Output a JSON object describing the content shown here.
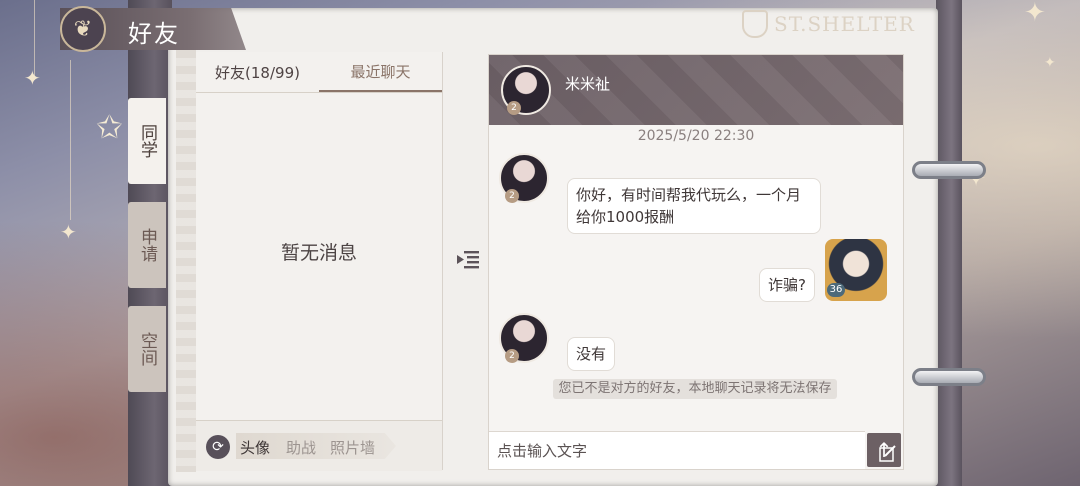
{
  "header": {
    "title": "好友",
    "brand": "ST.SHELTER"
  },
  "side_tabs": [
    {
      "label": "同学",
      "active": true
    },
    {
      "label": "申请",
      "active": false
    },
    {
      "label": "空间",
      "active": false
    }
  ],
  "friends_panel": {
    "tabs": [
      {
        "label": "好友(18/99)",
        "active": false
      },
      {
        "label": "最近聊天",
        "active": true
      }
    ],
    "empty_text": "暂无消息",
    "footer": {
      "options": [
        "头像",
        "助战",
        "照片墙"
      ],
      "active_index": 0
    }
  },
  "chat": {
    "contact_name": "米米祉",
    "contact_level": "2",
    "timestamp": "2025/5/20  22:30",
    "messages": [
      {
        "from": "other",
        "text": "你好，有时间帮我代玩么，一个月给你1000报酬",
        "level": "2"
      },
      {
        "from": "self",
        "text": "诈骗?",
        "level": "36"
      },
      {
        "from": "other",
        "text": "没有",
        "level": "2"
      }
    ],
    "notice": "您已不是对方的好友，本地聊天记录将无法保存",
    "input_placeholder": "点击输入文字"
  },
  "colors": {
    "accent": "#6c6064",
    "page": "#f1efec",
    "text": "#3f3737"
  },
  "icons": [
    "butterfly-emblem-icon",
    "shield-icon",
    "star-icon",
    "refresh-icon",
    "collapse-list-icon",
    "edit-icon",
    "send-arrow-icon"
  ]
}
